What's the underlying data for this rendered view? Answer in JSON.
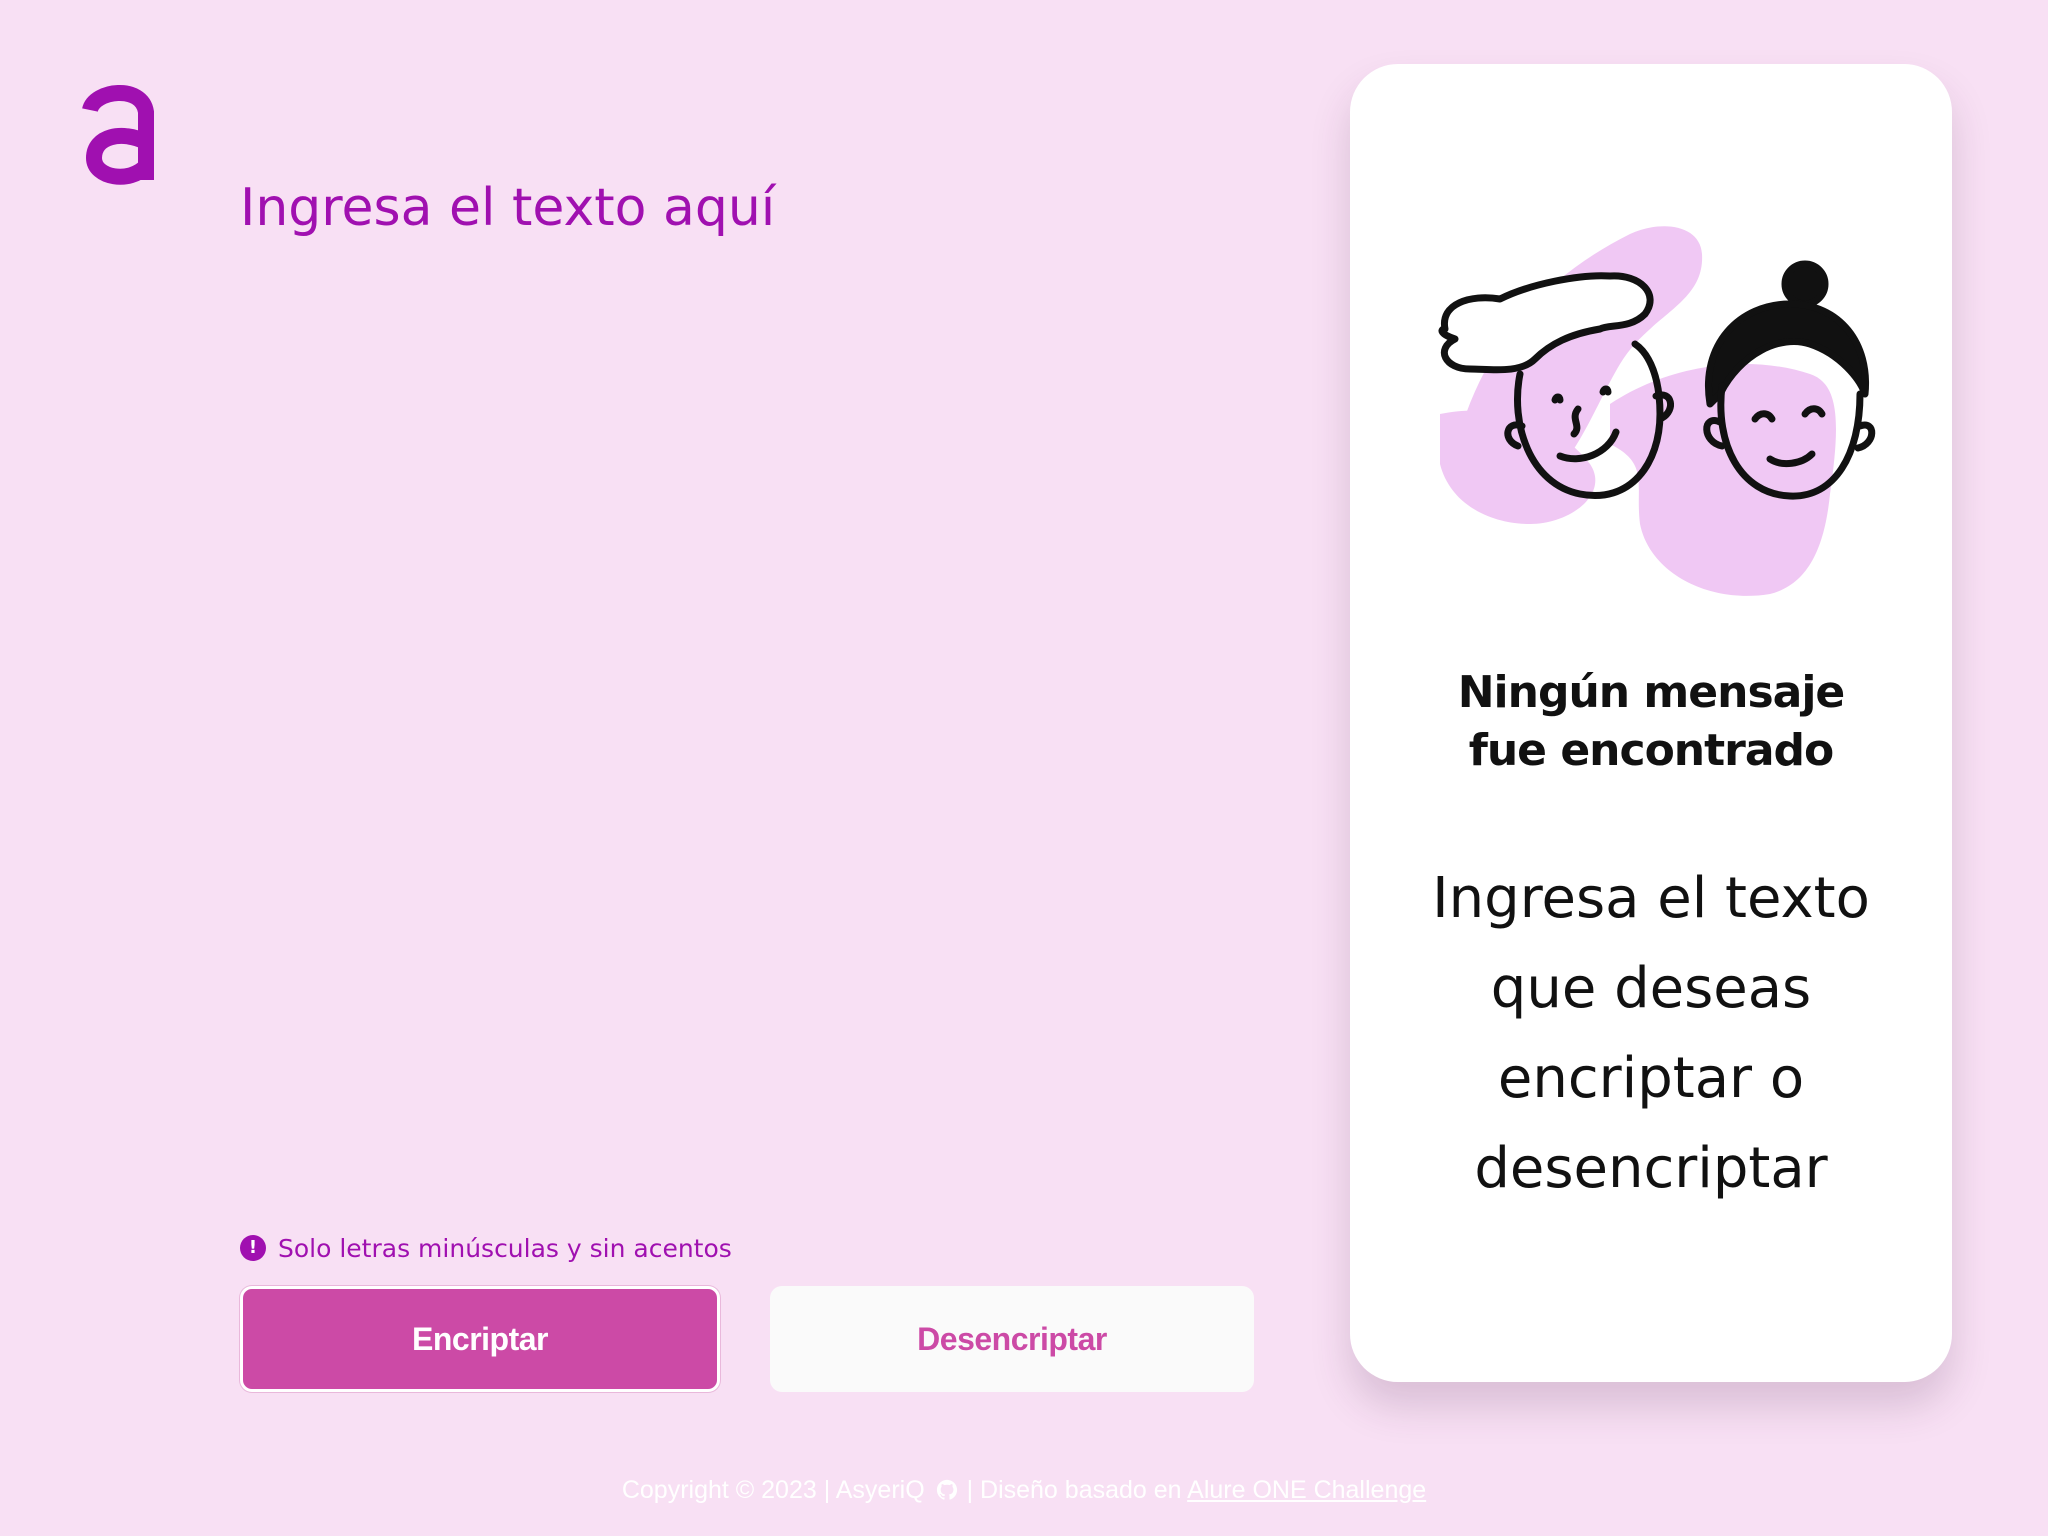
{
  "colors": {
    "background": "#f8e0f4",
    "accent": "#a010b0",
    "button_primary": "#cc4aa6",
    "panel": "#ffffff",
    "illustration_blob": "#f0c8f4"
  },
  "logo": {
    "icon": "letter-a-logo"
  },
  "input": {
    "placeholder": "Ingresa el texto aquí",
    "value": ""
  },
  "hint": {
    "icon": "exclamation-circle-icon",
    "text": "Solo letras minúsculas y sin acentos"
  },
  "buttons": {
    "encrypt": "Encriptar",
    "decrypt": "Desencriptar"
  },
  "panel": {
    "illustration": "two-faces-illustration",
    "title_line1": "Ningún mensaje",
    "title_line2": "fue encontrado",
    "text_line1": "Ingresa el texto",
    "text_line2": "que deseas",
    "text_line3": "encriptar o",
    "text_line4": "desencriptar"
  },
  "footer": {
    "copyright": "Copyright © 2023 | AsyeriQ",
    "github_icon": "github-icon",
    "separator": "| Diseño basado en",
    "link_text": "Alure ONE Challenge"
  }
}
